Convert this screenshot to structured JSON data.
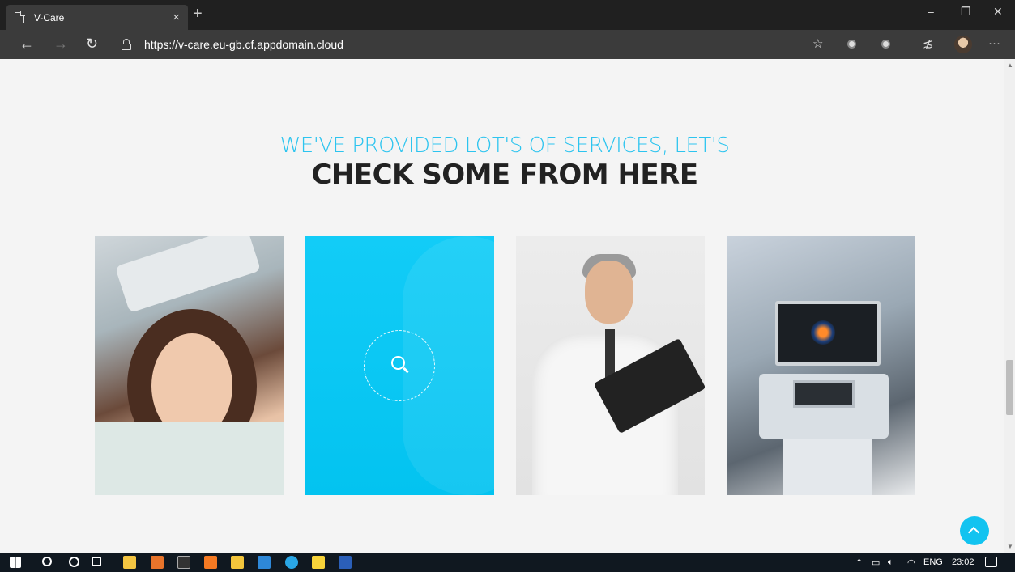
{
  "browser": {
    "tab_title": "V-Care",
    "tab_close": "×",
    "new_tab": "+",
    "url": "https://v-care.eu-gb.cf.appdomain.cloud",
    "win_minimize": "–",
    "win_restore": "❐",
    "win_close": "✕",
    "nav_back": "←",
    "nav_forward": "→",
    "nav_refresh": "↻",
    "favorite_star": "☆",
    "favorites_list": "≴",
    "more_menu": "···"
  },
  "section": {
    "subtitle": "WE'VE PROVIDED LOT'S OF SERVICES, LET'S",
    "title": "CHECK SOME FROM HERE"
  },
  "services": [
    {
      "icon": "facial-treatment-photo"
    },
    {
      "icon": "search-icon"
    },
    {
      "icon": "doctor-photo"
    },
    {
      "icon": "ultrasound-machine-photo"
    }
  ],
  "taskbar": {
    "language": "ENG",
    "time": "23:02",
    "icons": [
      "windows-start-icon",
      "search-icon",
      "cortana-icon",
      "task-view-icon",
      "store-icon",
      "sublime-icon",
      "cmd-icon",
      "xampp-icon",
      "file-explorer-icon",
      "mail-icon",
      "edge-icon",
      "sticky-notes-icon",
      "word-icon"
    ]
  },
  "colors": {
    "accent": "#12c3f0",
    "heading": "#222222",
    "subheading": "#2cc4ef"
  }
}
